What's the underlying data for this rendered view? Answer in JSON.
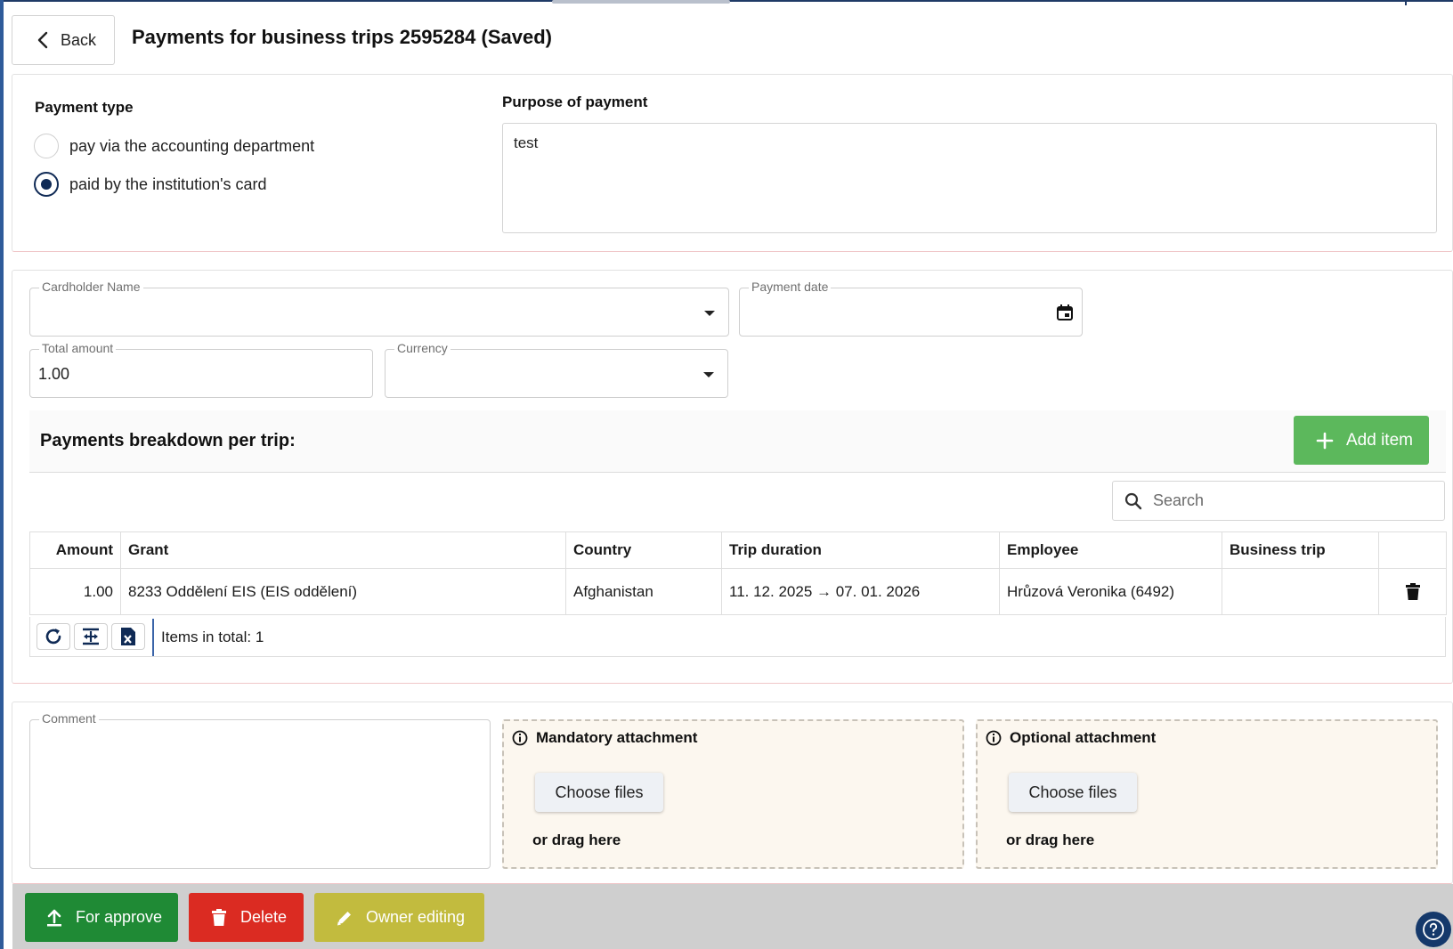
{
  "header": {
    "back_label": "Back",
    "title": "Payments for business trips 2595284 (Saved)"
  },
  "payment_type": {
    "label": "Payment type",
    "options": [
      {
        "label": "pay via the accounting department",
        "selected": false
      },
      {
        "label": "paid by the institution's card",
        "selected": true
      }
    ]
  },
  "purpose": {
    "label": "Purpose of payment",
    "value": "test"
  },
  "card_form": {
    "cardholder_label": "Cardholder Name",
    "cardholder_value": "",
    "payment_date_label": "Payment date",
    "payment_date_value": "",
    "total_amount_label": "Total amount",
    "total_amount_value": "1.00",
    "currency_label": "Currency",
    "currency_value": ""
  },
  "breakdown": {
    "title": "Payments breakdown per trip:",
    "add_label": "Add item",
    "search_placeholder": "Search",
    "columns": [
      "Amount",
      "Grant",
      "Country",
      "Trip duration",
      "Employee",
      "Business trip"
    ],
    "rows": [
      {
        "amount": "1.00",
        "grant": "8233 Oddělení EIS (EIS oddělení)",
        "country": "Afghanistan",
        "trip_duration": "11. 12. 2025 → 07. 01. 2026",
        "employee": "Hrůzová Veronika (6492)",
        "business_trip": ""
      }
    ],
    "total_text": "Items in total: 1"
  },
  "attachments": {
    "comment_label": "Comment",
    "comment_value": "",
    "mandatory_title": "Mandatory attachment",
    "optional_title": "Optional attachment",
    "choose_label": "Choose files",
    "drag_label": "or drag here"
  },
  "actions": {
    "approve_label": "For approve",
    "delete_label": "Delete",
    "owner_label": "Owner editing"
  },
  "colors": {
    "approve": "#1f8a35",
    "delete": "#db2b22",
    "owner": "#c2bb3e",
    "add": "#5cb85c",
    "accent": "#0f2a55"
  },
  "icons": {
    "back": "chevron-left-icon",
    "add": "plus-icon",
    "search": "search-icon",
    "calendar": "calendar-icon",
    "delete_row": "trash-icon",
    "refresh": "refresh-icon",
    "autosize": "fit-columns-icon",
    "excel": "excel-export-icon",
    "info": "info-icon",
    "upload": "upload-icon",
    "edit": "pencil-icon",
    "help": "help-icon"
  }
}
